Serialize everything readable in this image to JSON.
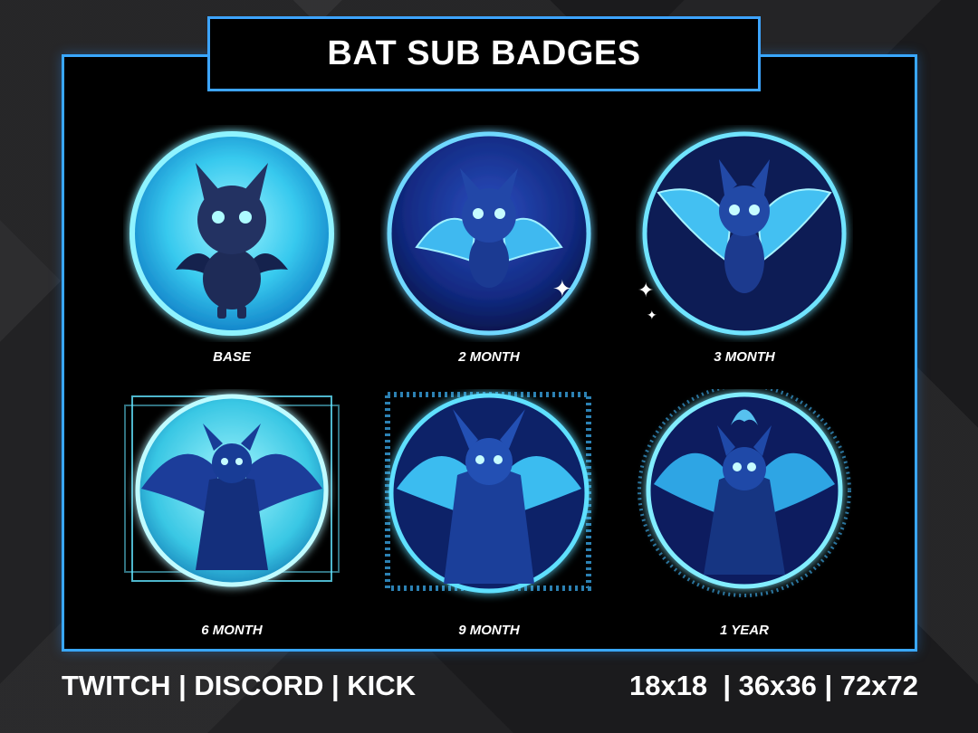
{
  "title": "BAT SUB BADGES",
  "badges": [
    {
      "label": "BASE",
      "icon": "bat-cute-icon"
    },
    {
      "label": "2 MONTH",
      "icon": "bat-small-wings-icon"
    },
    {
      "label": "3 MONTH",
      "icon": "bat-wide-wings-icon"
    },
    {
      "label": "6 MONTH",
      "icon": "vampire-bat-icon"
    },
    {
      "label": "9 MONTH",
      "icon": "furry-bat-icon"
    },
    {
      "label": "1 YEAR",
      "icon": "crowned-bat-icon"
    }
  ],
  "footer": {
    "platforms": "TWITCH | DISCORD | KICK",
    "sizes": "18x18  | 36x36 | 72x72"
  },
  "colors": {
    "accent": "#39a7ff",
    "glow": "#4fe0ff",
    "badge_dark": "#0c1c5a"
  }
}
